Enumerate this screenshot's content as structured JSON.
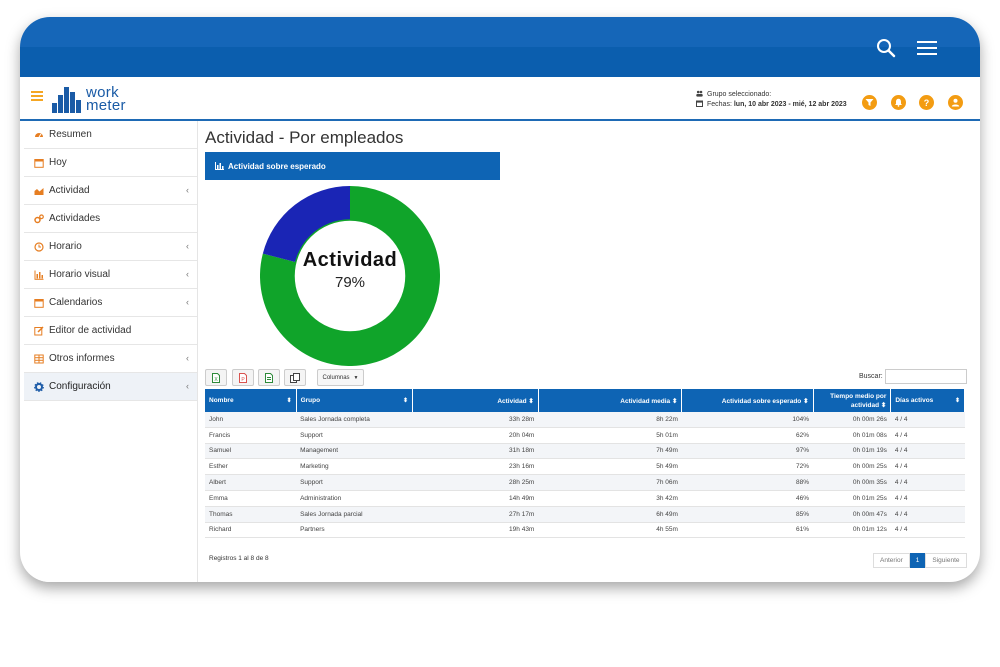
{
  "app": {
    "logo_line1": "work",
    "logo_line2": "meter"
  },
  "header": {
    "group_label": "Grupo seleccionado:",
    "dates_label": "Fechas:",
    "dates_value": "lun, 10 abr 2023 - mié, 12 abr 2023"
  },
  "sidebar": {
    "items": [
      {
        "label": "Resumen",
        "icon": "dashboard-icon",
        "chevron": false
      },
      {
        "label": "Hoy",
        "icon": "calendar-icon",
        "chevron": false
      },
      {
        "label": "Actividad",
        "icon": "area-chart-icon",
        "chevron": true
      },
      {
        "label": "Actividades",
        "icon": "gears-icon",
        "chevron": false
      },
      {
        "label": "Horario",
        "icon": "clock-icon",
        "chevron": true
      },
      {
        "label": "Horario visual",
        "icon": "bar-chart-icon",
        "chevron": true
      },
      {
        "label": "Calendarios",
        "icon": "calendar-icon",
        "chevron": true
      },
      {
        "label": "Editor de actividad",
        "icon": "edit-icon",
        "chevron": false
      },
      {
        "label": "Otros informes",
        "icon": "table-icon",
        "chevron": true
      },
      {
        "label": "Configuración",
        "icon": "gear-icon",
        "chevron": true,
        "active": true
      }
    ]
  },
  "main": {
    "title": "Actividad - Por empleados",
    "panel_title": "Actividad sobre esperado",
    "donut": {
      "label": "Actividad",
      "value_text": "79%",
      "value": 79,
      "color_main": "#10a42a",
      "color_rest": "#1a25b5"
    },
    "toolbar": {
      "columns_label": "Columnas"
    },
    "search_label": "Buscar:",
    "search_value": "",
    "table": {
      "headers": [
        "Nombre",
        "Grupo",
        "Actividad",
        "Actividad media",
        "Actividad sobre esperado",
        "Tiempo medio por actividad",
        "Días activos"
      ],
      "rows": [
        [
          "John",
          "Sales Jornada completa",
          "33h 28m",
          "8h 22m",
          "104%",
          "0h 00m 26s",
          "4 / 4"
        ],
        [
          "Francis",
          "Support",
          "20h 04m",
          "5h 01m",
          "62%",
          "0h 01m 08s",
          "4 / 4"
        ],
        [
          "Samuel",
          "Management",
          "31h 18m",
          "7h 49m",
          "97%",
          "0h 01m 19s",
          "4 / 4"
        ],
        [
          "Esther",
          "Marketing",
          "23h 16m",
          "5h 49m",
          "72%",
          "0h 00m 25s",
          "4 / 4"
        ],
        [
          "Albert",
          "Support",
          "28h 25m",
          "7h 06m",
          "88%",
          "0h 00m 35s",
          "4 / 4"
        ],
        [
          "Emma",
          "Administration",
          "14h 49m",
          "3h 42m",
          "46%",
          "0h 01m 25s",
          "4 / 4"
        ],
        [
          "Thomas",
          "Sales Jornada parcial",
          "27h 17m",
          "6h 49m",
          "85%",
          "0h 00m 47s",
          "4 / 4"
        ],
        [
          "Richard",
          "Partners",
          "19h 43m",
          "4h 55m",
          "61%",
          "0h 01m 12s",
          "4 / 4"
        ]
      ]
    },
    "info": "Registros 1 al 8 de 8",
    "pager": {
      "prev": "Anterior",
      "current": "1",
      "next": "Siguiente"
    }
  }
}
